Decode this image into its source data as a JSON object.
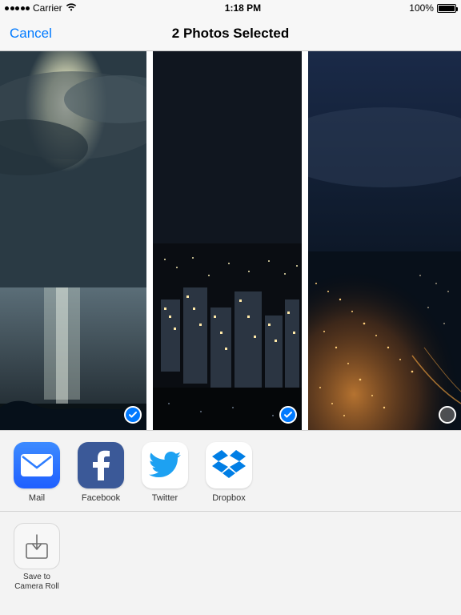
{
  "status": {
    "carrier": "Carrier",
    "wifi": "wifi",
    "time": "1:18 PM",
    "battery_pct": "100%"
  },
  "nav": {
    "cancel": "Cancel",
    "title": "2 Photos Selected"
  },
  "photos": [
    {
      "selected": true
    },
    {
      "selected": true
    },
    {
      "selected": false
    }
  ],
  "share_apps": [
    {
      "id": "mail",
      "label": "Mail"
    },
    {
      "id": "facebook",
      "label": "Facebook"
    },
    {
      "id": "twitter",
      "label": "Twitter"
    },
    {
      "id": "dropbox",
      "label": "Dropbox"
    }
  ],
  "actions": [
    {
      "id": "save-camera-roll",
      "label": "Save to\nCamera Roll"
    }
  ]
}
